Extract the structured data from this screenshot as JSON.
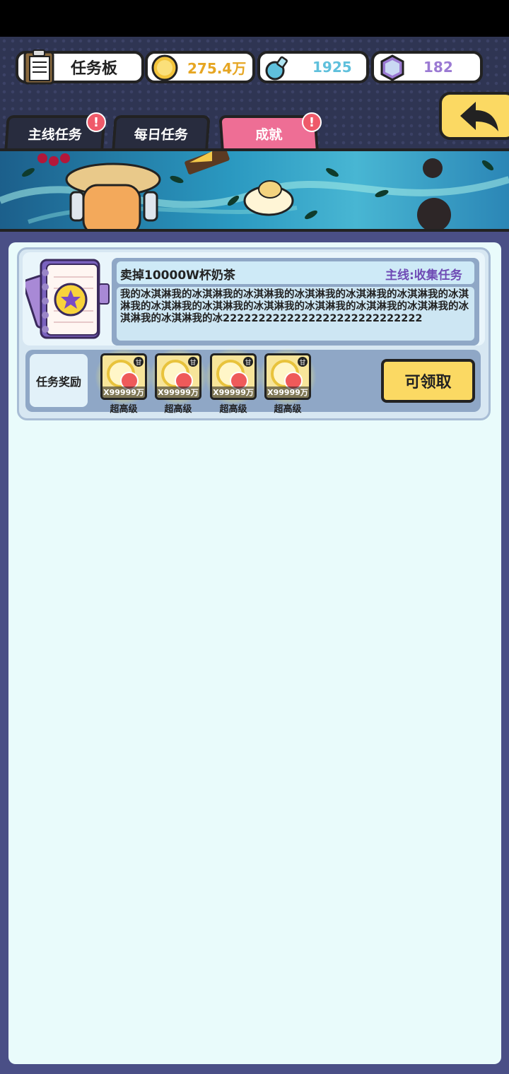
{
  "topbar": {
    "board_label": "任务板",
    "gold_value": "275.4万",
    "bottle_value": "1925",
    "gem_value": "182",
    "colors": {
      "gold": "#e6a623",
      "bottle": "#5fc0dc",
      "gem": "#9b7ad3"
    }
  },
  "tabs": [
    {
      "label": "主线任务",
      "alert": "!"
    },
    {
      "label": "每日任务"
    },
    {
      "label": "成就",
      "alert": "!"
    }
  ],
  "task": {
    "title": "卖掉10000W杯奶茶",
    "type": "主线:收集任务",
    "description": "我的冰淇淋我的冰淇淋我的冰淇淋我的冰淇淋我的冰淇淋我的冰淇淋我的冰淇淋我的冰淇淋我的冰淇淋我的冰淇淋我的冰淇淋我的冰淇淋我的冰淇淋我的冰淇淋我的冰淇淋我的冰2222222222222222222222222222",
    "reward_label": "任务奖励",
    "rewards": [
      {
        "qty": "X99999万",
        "grade": "超高级",
        "tag": "甘"
      },
      {
        "qty": "X99999万",
        "grade": "超高级",
        "tag": "甘"
      },
      {
        "qty": "X99999万",
        "grade": "超高级",
        "tag": "甘"
      },
      {
        "qty": "X99999万",
        "grade": "超高级",
        "tag": "甘"
      }
    ],
    "claim_label": "可领取"
  },
  "icons": [
    "clipboard-icon",
    "gold-coin-icon",
    "potion-bottle-icon",
    "hexagon-gem-icon",
    "back-arrow-icon",
    "notebook-star-icon",
    "lemon-slice-icon"
  ]
}
